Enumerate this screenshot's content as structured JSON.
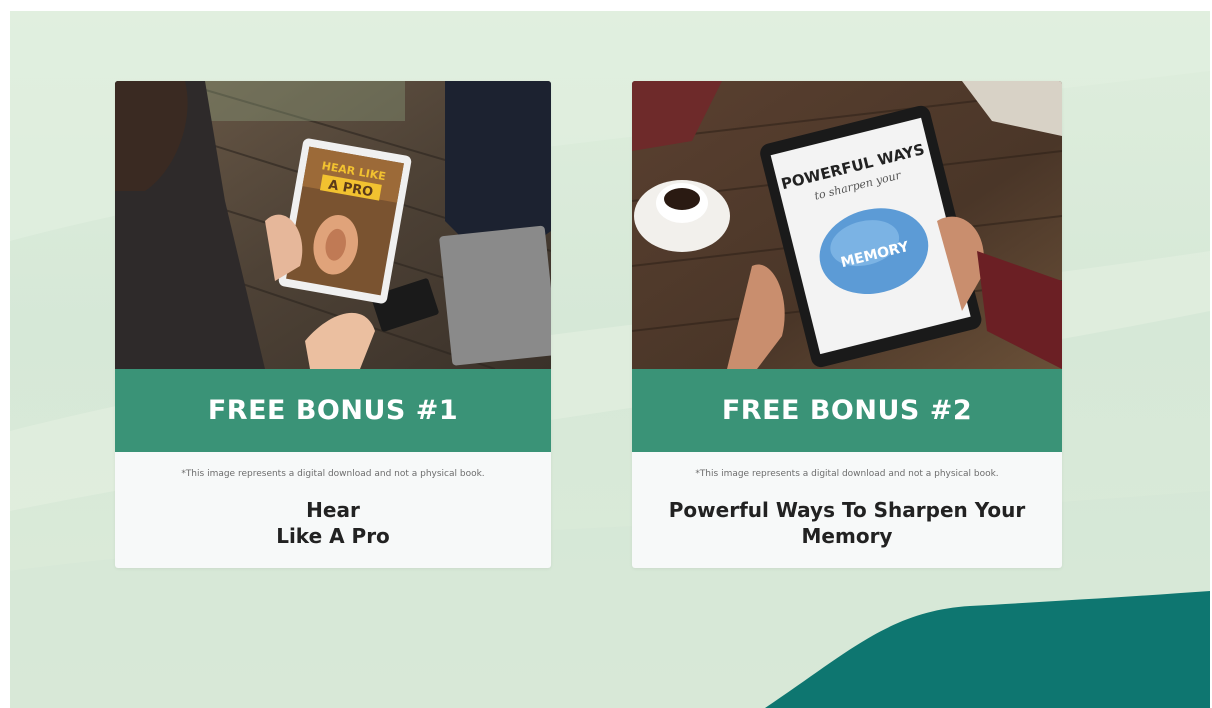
{
  "bonuses": [
    {
      "heading": "FREE BONUS #1",
      "disclaimer": "*This image represents a digital download and not a physical book.",
      "title_line1": "Hear",
      "title_line2": "Like A Pro",
      "tablet_text_1": "HEAR LIKE",
      "tablet_text_2": "A PRO"
    },
    {
      "heading": "FREE BONUS #2",
      "disclaimer": "*This image represents a digital download and not a physical book.",
      "title_line1": "Powerful Ways To Sharpen Your",
      "title_line2": "Memory",
      "tablet_text_1": "POWERFUL WAYS",
      "tablet_text_2": "to sharpen your",
      "tablet_text_3": "MEMORY"
    }
  ],
  "colors": {
    "band": "#3a9377",
    "background": "#d9ead8",
    "wave": "#0e7670"
  }
}
